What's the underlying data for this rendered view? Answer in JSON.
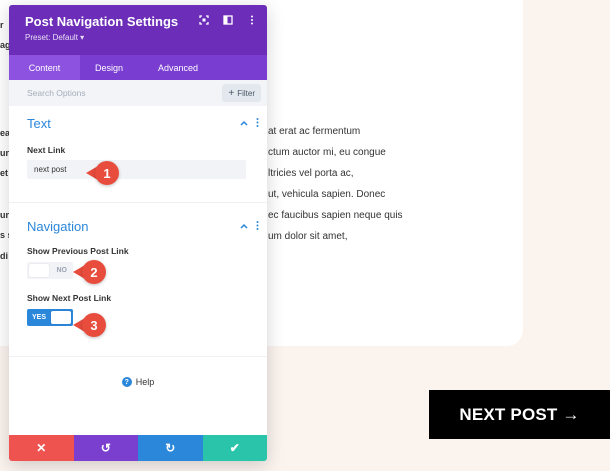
{
  "background": {
    "fragments": [
      "r",
      "ag",
      "ea",
      "un",
      "et",
      "un",
      "s s",
      "di"
    ],
    "lines": [
      "at erat ac fermentum",
      "ctum auctor mi, eu congue",
      "ltricies vel porta ac,",
      "ut, vehicula sapien. Donec",
      "ec faucibus sapien neque quis",
      "um dolor sit amet,"
    ],
    "next_post_button": "NEXT POST →"
  },
  "panel": {
    "title": "Post Navigation Settings",
    "preset": "Preset: Default ▾",
    "tabs": [
      "Content",
      "Design",
      "Advanced"
    ],
    "search_placeholder": "Search Options",
    "filter_label": "Filter",
    "text_section": {
      "title": "Text",
      "next_link_label": "Next Link",
      "next_link_value": "next post"
    },
    "navigation_section": {
      "title": "Navigation",
      "show_previous_label": "Show Previous Post Link",
      "show_previous_state": "NO",
      "show_next_label": "Show Next Post Link",
      "show_next_state": "YES"
    },
    "help_label": "Help"
  },
  "markers": [
    "1",
    "2",
    "3"
  ],
  "colors": {
    "header": "#6c2eb9",
    "tabs": "#7a3dd1",
    "accent_blue": "#2b87da",
    "marker": "#e84c3d",
    "footer_cancel": "#ef5350",
    "footer_undo": "#7b3fd0",
    "footer_redo": "#2b87da",
    "footer_save": "#29c4a9"
  },
  "icons": [
    "fullscreen-icon",
    "sidebar-toggle-icon",
    "more-options-icon",
    "filter-plus-icon",
    "collapse-chevron-icon",
    "section-more-icon",
    "help-icon",
    "close-icon",
    "undo-icon",
    "redo-icon",
    "checkmark-icon"
  ]
}
